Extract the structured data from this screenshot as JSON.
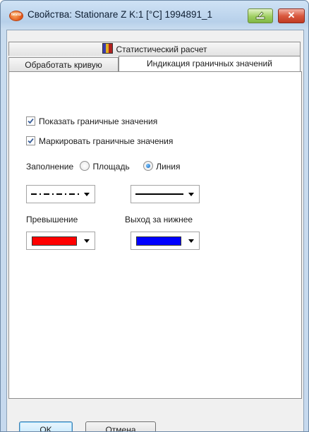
{
  "window": {
    "title": "Свойства: Stationare Z K:1 [°C] 1994891_1",
    "app_icon_text": "testo",
    "close_glyph": "✕"
  },
  "tabs": {
    "top_row": [
      {
        "label": "Статистический расчет",
        "icon": "statistics-icon"
      }
    ],
    "bottom_row": [
      {
        "label": "Обработать кривую"
      },
      {
        "label": "Индикация граничных значений",
        "active": true
      }
    ]
  },
  "panel": {
    "show_limits": {
      "label": "Показать граничные значения",
      "checked": true
    },
    "mark_limits": {
      "label": "Маркировать граничные значения",
      "checked": true
    },
    "fill": {
      "label": "Заполнение",
      "options": [
        {
          "label": "Площадь",
          "selected": false
        },
        {
          "label": "Линия",
          "selected": true
        }
      ]
    },
    "line_style_left": "dash-dot",
    "line_style_right": "solid",
    "exceed": {
      "label": "Превышение",
      "color": "#ff0000"
    },
    "below": {
      "label": "Выход за нижнее",
      "color": "#0000ff"
    }
  },
  "buttons": {
    "ok": "OK",
    "cancel": "Отмена"
  }
}
